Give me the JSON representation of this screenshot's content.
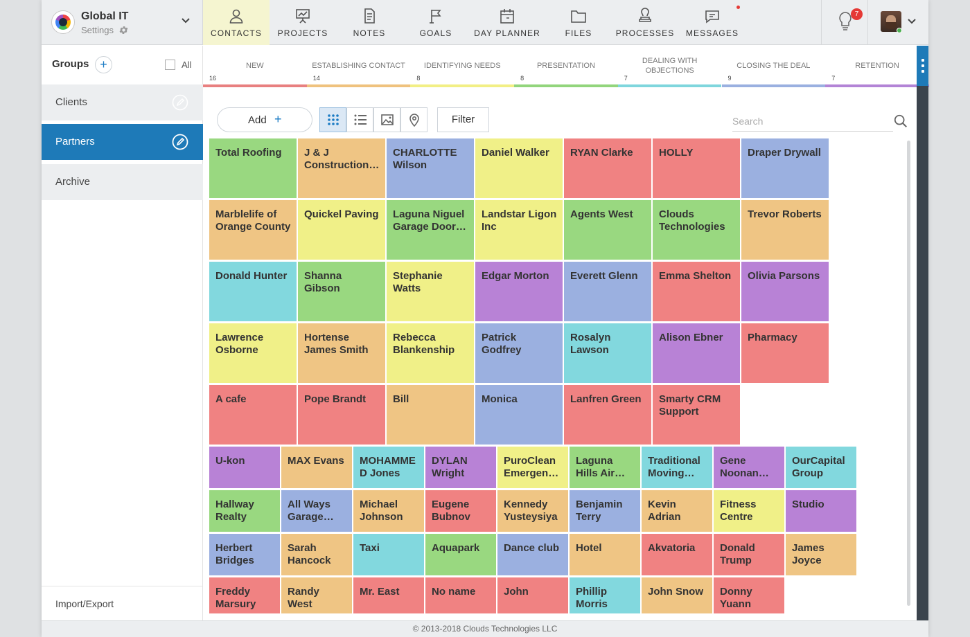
{
  "app": {
    "name": "Global IT",
    "settings_label": "Settings"
  },
  "nav": [
    {
      "label": "CONTACTS",
      "icon": "person-icon",
      "active": true
    },
    {
      "label": "PROJECTS",
      "icon": "easel-icon",
      "active": false
    },
    {
      "label": "NOTES",
      "icon": "note-icon",
      "active": false
    },
    {
      "label": "GOALS",
      "icon": "flag-icon",
      "active": false
    },
    {
      "label": "DAY PLANNER",
      "icon": "calendar-icon",
      "active": false
    },
    {
      "label": "FILES",
      "icon": "folder-icon",
      "active": false
    },
    {
      "label": "PROCESSES",
      "icon": "stamp-icon",
      "active": false
    },
    {
      "label": "MESSAGES",
      "icon": "chat-icon",
      "active": false
    }
  ],
  "notifications": {
    "count": "7",
    "icon": "lightbulb-icon"
  },
  "sidebar": {
    "title": "Groups",
    "add_symbol": "+",
    "all_label": "All",
    "items": [
      {
        "label": "Clients",
        "active": false
      },
      {
        "label": "Partners",
        "active": true
      },
      {
        "label": "Archive",
        "active": false
      }
    ],
    "import_export": "Import/Export"
  },
  "pipeline": [
    {
      "name": "NEW",
      "count": "16",
      "color": "#e88080"
    },
    {
      "name": "ESTABLISHING CONTACT",
      "count": "14",
      "color": "#efc27e"
    },
    {
      "name": "IDENTIFYING NEEDS",
      "count": "8",
      "color": "#f2ef85"
    },
    {
      "name": "PRESENTATION",
      "count": "8",
      "color": "#92d57c"
    },
    {
      "name": "DEALING WITH OBJECTIONS",
      "count": "7",
      "color": "#7fd6dd"
    },
    {
      "name": "CLOSING THE DEAL",
      "count": "9",
      "color": "#9ab0e0"
    },
    {
      "name": "RETENTION",
      "count": "7",
      "color": "#b384d6"
    }
  ],
  "toolbar": {
    "add_label": "Add",
    "add_symbol": "+",
    "views": [
      "grid-view-icon",
      "list-view-icon",
      "image-view-icon",
      "map-pin-icon"
    ],
    "filter_label": "Filter",
    "search_placeholder": "Search"
  },
  "palette": {
    "green": "#99d880",
    "orange": "#efc584",
    "blue": "#9bb0e0",
    "yellow": "#f0f088",
    "red": "#f08282",
    "cyan": "#82d8de",
    "purple": "#b882d6"
  },
  "contacts": [
    {
      "name": "Total Roofing",
      "color": "green"
    },
    {
      "name": "J & J Construction Inc",
      "color": "orange"
    },
    {
      "name": "CHARLOTTE Wilson",
      "color": "blue"
    },
    {
      "name": "Daniel Walker",
      "color": "yellow"
    },
    {
      "name": "RYAN Clarke",
      "color": "red"
    },
    {
      "name": "HOLLY",
      "color": "red"
    },
    {
      "name": "Draper Drywall",
      "color": "blue"
    },
    {
      "name": "Marblelife of Orange County",
      "color": "orange"
    },
    {
      "name": "Quickel Paving",
      "color": "yellow"
    },
    {
      "name": "Laguna Niguel Garage Door Repair",
      "color": "green"
    },
    {
      "name": "Landstar Ligon Inc",
      "color": "yellow"
    },
    {
      "name": "Agents West",
      "color": "green"
    },
    {
      "name": "Clouds Technologies",
      "color": "green"
    },
    {
      "name": "Trevor Roberts",
      "color": "orange"
    },
    {
      "name": "Donald Hunter",
      "color": "cyan"
    },
    {
      "name": "Shanna Gibson",
      "color": "green"
    },
    {
      "name": "Stephanie Watts",
      "color": "yellow"
    },
    {
      "name": "Edgar Morton",
      "color": "purple"
    },
    {
      "name": "Everett Glenn",
      "color": "blue"
    },
    {
      "name": "Emma Shelton",
      "color": "red"
    },
    {
      "name": "Olivia Parsons",
      "color": "purple"
    },
    {
      "name": "Lawrence Osborne",
      "color": "yellow"
    },
    {
      "name": "Hortense James Smith",
      "color": "orange"
    },
    {
      "name": "Rebecca Blankenship",
      "color": "yellow"
    },
    {
      "name": "Patrick Godfrey",
      "color": "blue"
    },
    {
      "name": "Rosalyn Lawson",
      "color": "cyan"
    },
    {
      "name": "Alison Ebner",
      "color": "purple"
    },
    {
      "name": "Pharmacy",
      "color": "red"
    },
    {
      "name": "A cafe",
      "color": "red"
    },
    {
      "name": "Pope Brandt",
      "color": "red"
    },
    {
      "name": "Bill",
      "color": "orange"
    },
    {
      "name": "Monica",
      "color": "blue"
    },
    {
      "name": "Lanfren Green",
      "color": "red"
    },
    {
      "name": "Smarty CRM Support",
      "color": "red"
    },
    {
      "name": "U-kon",
      "color": "purple"
    },
    {
      "name": "MAX Evans",
      "color": "orange"
    },
    {
      "name": "MOHAMMED Jones",
      "color": "cyan"
    },
    {
      "name": "DYLAN Wright",
      "color": "purple"
    },
    {
      "name": "PuroClean Emergency Restoration",
      "color": "yellow"
    },
    {
      "name": "Laguna Hills Air Conditioning",
      "color": "green"
    },
    {
      "name": "Traditional Moving Company",
      "color": "cyan"
    },
    {
      "name": "Gene Noonan Smith",
      "color": "purple"
    },
    {
      "name": "OurCapital Group",
      "color": "cyan"
    },
    {
      "name": "Hallway Realty",
      "color": "green"
    },
    {
      "name": "All Ways Garage Doors",
      "color": "blue"
    },
    {
      "name": "Michael Johnson",
      "color": "orange"
    },
    {
      "name": "Eugene Bubnov",
      "color": "red"
    },
    {
      "name": "Kennedy Yusteysiya",
      "color": "orange"
    },
    {
      "name": "Benjamin Terry",
      "color": "blue"
    },
    {
      "name": "Kevin Adrian",
      "color": "orange"
    },
    {
      "name": "Fitness Centre",
      "color": "yellow"
    },
    {
      "name": "Studio",
      "color": "purple"
    },
    {
      "name": "Herbert Bridges",
      "color": "blue"
    },
    {
      "name": "Sarah Hancock",
      "color": "orange"
    },
    {
      "name": "Taxi",
      "color": "cyan"
    },
    {
      "name": "Aquapark",
      "color": "green"
    },
    {
      "name": "Dance club",
      "color": "blue"
    },
    {
      "name": "Hotel",
      "color": "orange"
    },
    {
      "name": "Akvatoria",
      "color": "red"
    },
    {
      "name": "Donald Trump",
      "color": "red"
    },
    {
      "name": "James Joyce",
      "color": "orange"
    },
    {
      "name": "Freddy Marsury",
      "color": "red"
    },
    {
      "name": "Randy West",
      "color": "orange"
    },
    {
      "name": "Mr. East",
      "color": "red"
    },
    {
      "name": "No name",
      "color": "red"
    },
    {
      "name": "John",
      "color": "red"
    },
    {
      "name": "Phillip Morris",
      "color": "cyan"
    },
    {
      "name": "John Snow",
      "color": "orange"
    },
    {
      "name": "Donny Yuann",
      "color": "red"
    }
  ],
  "footer": "© 2013-2018 Clouds Technologies LLC"
}
